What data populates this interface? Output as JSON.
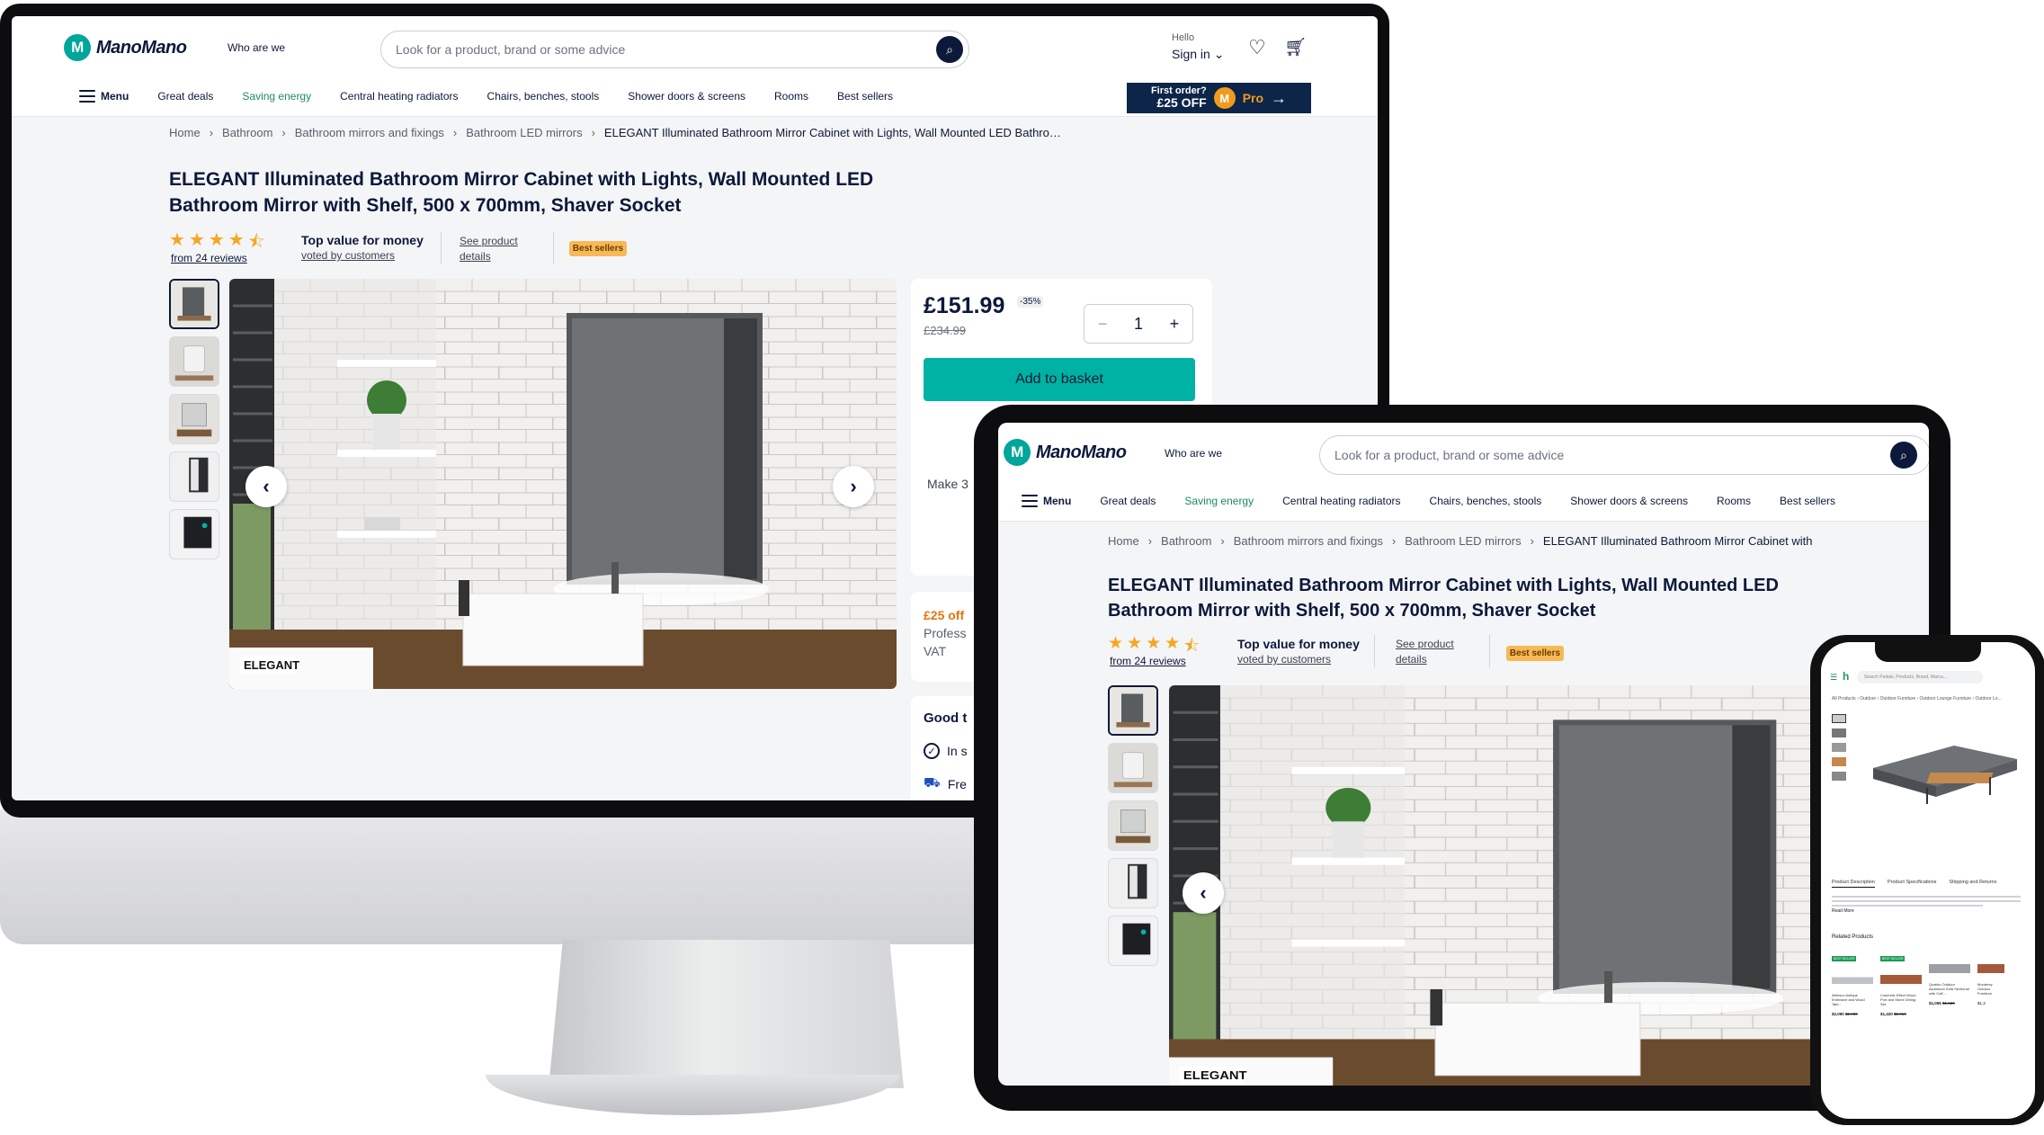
{
  "site": {
    "brand": "ManoMano",
    "who_are_we": "Who are we",
    "search_placeholder": "Look for a product, brand or some advice",
    "hello": "Hello",
    "sign_in": "Sign in",
    "menu": "Menu",
    "nav": [
      "Great deals",
      "Saving energy",
      "Central heating radiators",
      "Chairs, benches, stools",
      "Shower doors & screens",
      "Rooms",
      "Best sellers"
    ],
    "pro_banner": {
      "line1": "First order?",
      "line2": "£25 OFF",
      "badge": "M",
      "badge_text": "Pro"
    }
  },
  "breadcrumb": [
    "Home",
    "Bathroom",
    "Bathroom mirrors and fixings",
    "Bathroom LED mirrors"
  ],
  "breadcrumb_current_desktop": "ELEGANT Illuminated Bathroom Mirror Cabinet with Lights, Wall Mounted LED Bathro…",
  "breadcrumb_current_tablet": "ELEGANT Illuminated Bathroom Mirror Cabinet with",
  "product": {
    "title_line1": "ELEGANT Illuminated Bathroom Mirror Cabinet with Lights, Wall Mounted LED",
    "title_line2": "Bathroom Mirror with Shelf, 500 x 700mm, Shaver Socket",
    "rating": 4.5,
    "reviews": "from 24 reviews",
    "top_value": "Top value for money",
    "voted": "voted by customers",
    "see_product_1": "See product",
    "see_product_2": "details",
    "best_sellers": "Best sellers",
    "image_brand": "ELEGANT"
  },
  "purchase": {
    "price": "£151.99",
    "discount": "-35%",
    "old_price": "£234.99",
    "quantity": "1",
    "add_to_basket": "Add to basket",
    "make": "Make 3",
    "promo": "£25 off",
    "profess": "Profess",
    "vat": "VAT",
    "good": "Good t",
    "in_stock": "In s",
    "free": "Fre"
  },
  "phone": {
    "search_placeholder": "Search Pedals, Products, Brand, Marca...",
    "crumbs": "All Products  ›  Outdoor  ›  Outdoor Furniture  ›  Outdoor Lounge Furniture  ›  Outdoor Lo...",
    "tabs": [
      "Product Description",
      "Product Specifications",
      "Shipping and Returns"
    ],
    "read_more": "Read More",
    "related": "Related Products",
    "best_seller_tag": "BEST SELLER",
    "related_items": [
      {
        "name": "Alfresco Antique Extensive and Wood Tabl...",
        "price": "$2,090",
        "old": "$2,980"
      },
      {
        "name": "Cosmetic Effect Wood Port and Stone Dining Set",
        "price": "$1,420",
        "old": "$2,010"
      },
      {
        "name": "Quattro Outdoor Aluminum Sofa Sectional with Coff...",
        "price": "$1,055",
        "old": "$1,620"
      },
      {
        "name": "Monterey Outdoor Furniture",
        "price": "$1,3",
        "old": ""
      }
    ]
  },
  "colors": {
    "navy": "#0c193a",
    "teal": "#00b2a4",
    "green_nav": "#1e8c5a",
    "best_seller_badge": "#f7b955",
    "pro_banner": "#0c2548",
    "promo_orange": "#e8730c"
  }
}
